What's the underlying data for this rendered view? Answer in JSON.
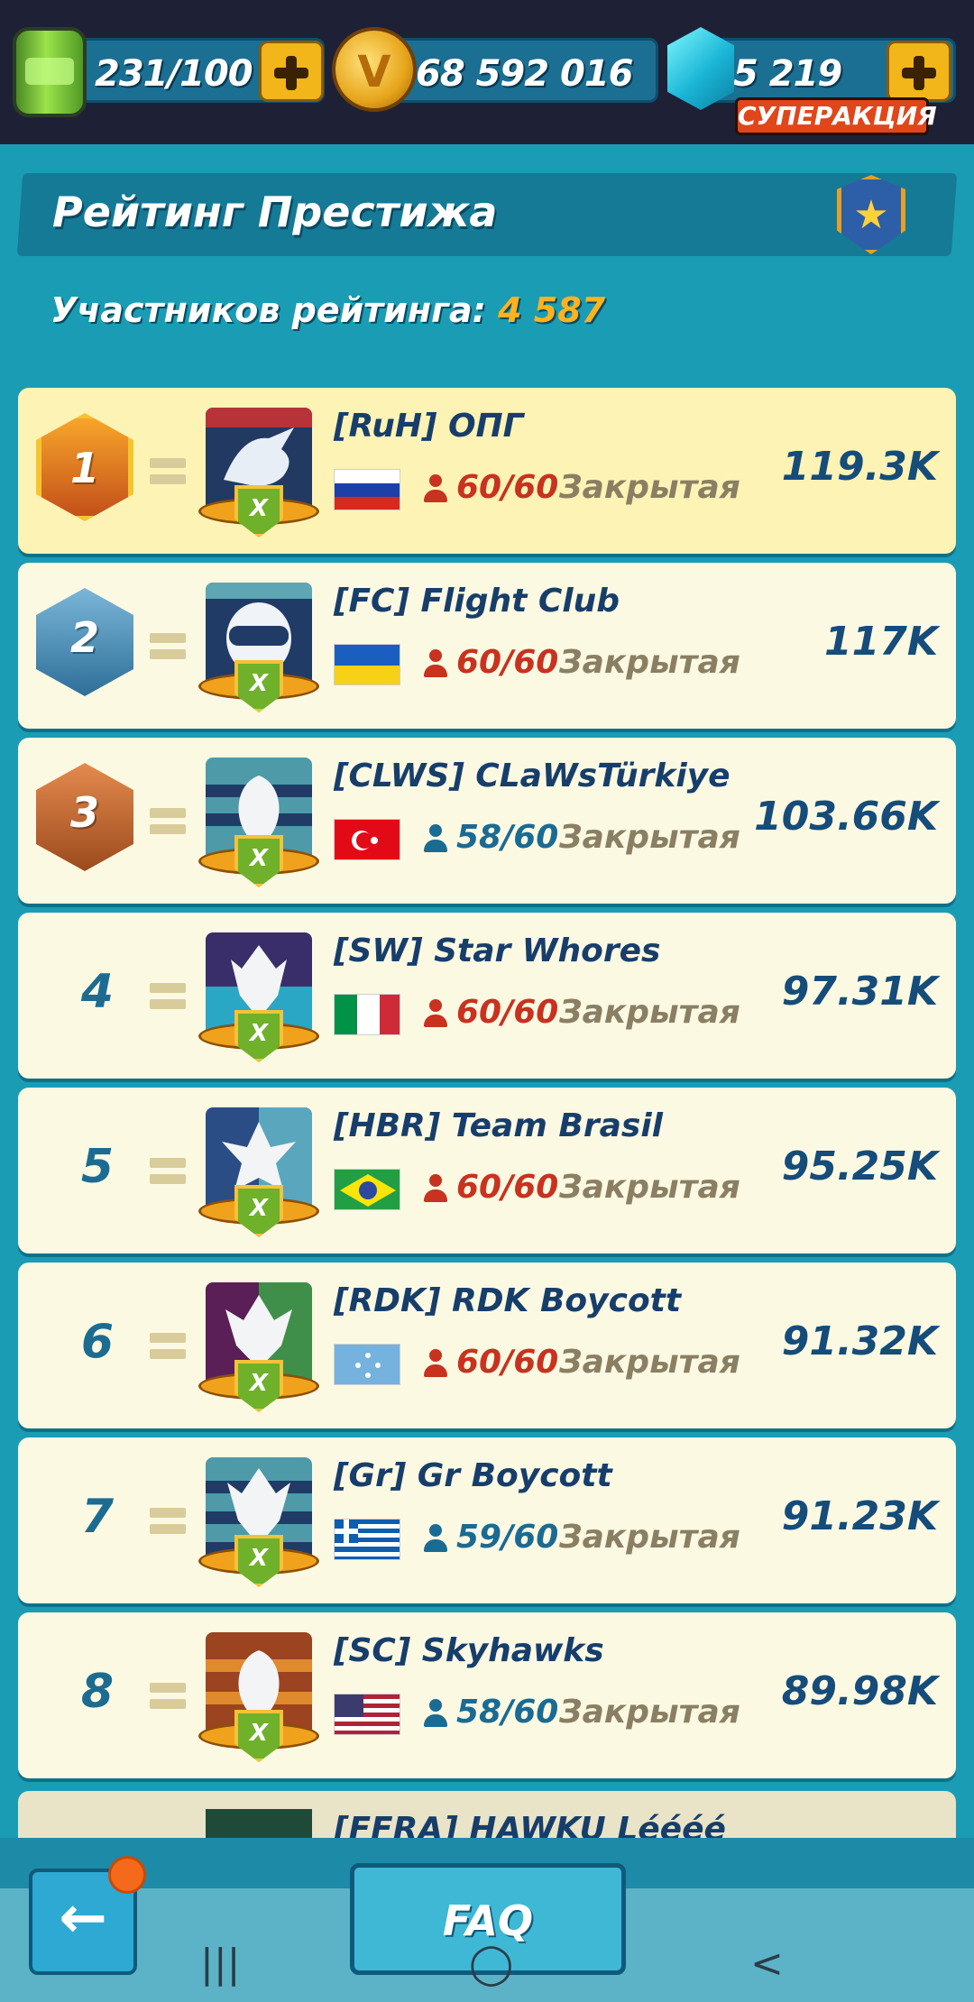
{
  "resources": {
    "energy": "231/100",
    "coins": "68 592 016",
    "gems": "5 219",
    "super_label": "СУПЕРАКЦИЯ"
  },
  "header": {
    "title": "Рейтинг Престижа",
    "participants_label": "Участников рейтинга:",
    "participants_count": "4 587"
  },
  "clans": [
    {
      "rank": "1",
      "name": "[RuH] ОПГ",
      "members": "60/60",
      "status": "Закрытая",
      "score": "119.3K"
    },
    {
      "rank": "2",
      "name": "[FC] Flight Club",
      "members": "60/60",
      "status": "Закрытая",
      "score": "117K"
    },
    {
      "rank": "3",
      "name": "[CLWS] CLaWsTürkiye",
      "members": "58/60",
      "status": "Закрытая",
      "score": "103.66K"
    },
    {
      "rank": "4",
      "name": "[SW] Star Whores",
      "members": "60/60",
      "status": "Закрытая",
      "score": "97.31K"
    },
    {
      "rank": "5",
      "name": "[HBR] Team Brasil",
      "members": "60/60",
      "status": "Закрытая",
      "score": "95.25K"
    },
    {
      "rank": "6",
      "name": "[RDK] RDK Boycott",
      "members": "60/60",
      "status": "Закрытая",
      "score": "91.32K"
    },
    {
      "rank": "7",
      "name": "[Gr] Gr Boycott",
      "members": "59/60",
      "status": "Закрытая",
      "score": "91.23K"
    },
    {
      "rank": "8",
      "name": "[SC] Skyhawks",
      "members": "58/60",
      "status": "Закрытая",
      "score": "89.98K"
    }
  ],
  "partial_clan": "[FFRA] HAWKU Léééé",
  "emblem_letter": "X",
  "buttons": {
    "back": "←",
    "faq": "FAQ"
  },
  "android_nav": {
    "recents": "|||",
    "home": "◯",
    "back": "<"
  },
  "colors": {
    "full_members": "#c8321f",
    "open_members": "#1a6b94",
    "score": "#154c7a",
    "accent_count": "#ffb21c"
  },
  "icons": {
    "energy": "energy-canister-icon",
    "coin": "coin-icon",
    "gem": "gem-icon",
    "plus": "plus-icon",
    "star_badge": "star-badge-icon",
    "member": "person-icon",
    "trend": "equal-trend-icon"
  }
}
